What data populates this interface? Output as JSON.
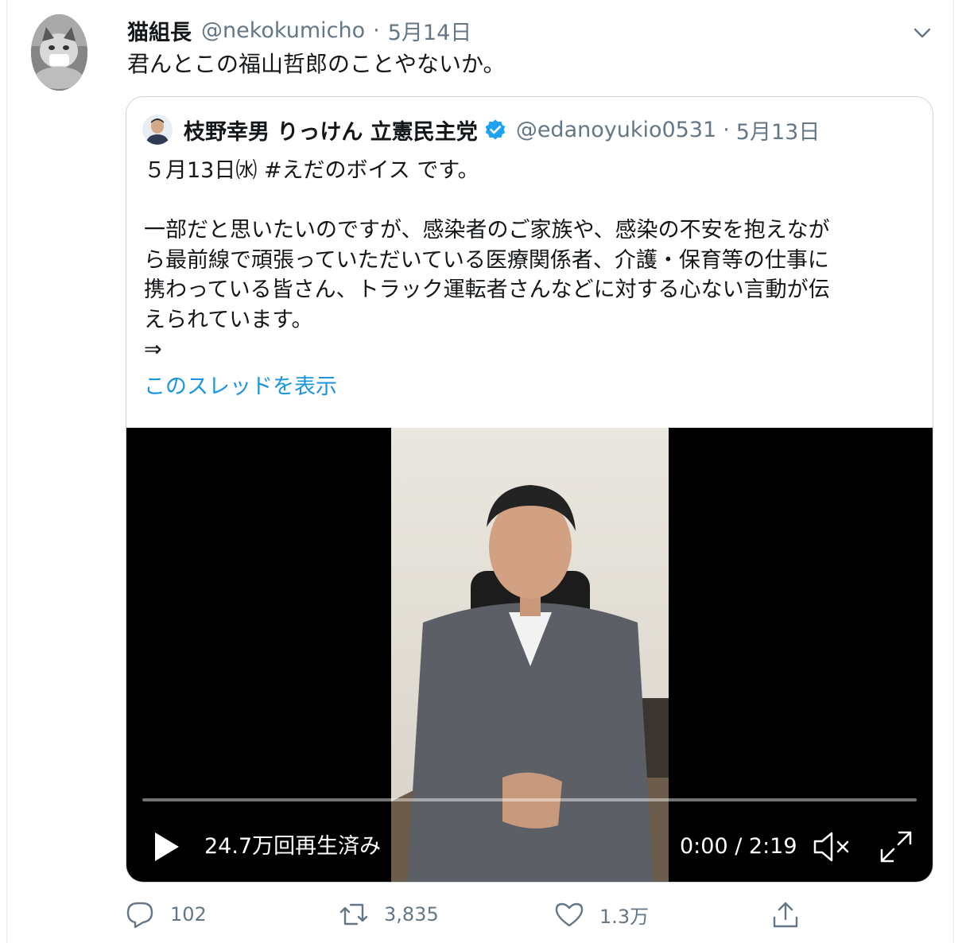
{
  "tweet": {
    "display_name": "猫組長",
    "handle": "@nekokumicho",
    "separator": "·",
    "time": "5月14日",
    "text": "君んとこの福山哲郎のことやないか。"
  },
  "quoted_tweet": {
    "display_name": "枝野幸男 りっけん 立憲民主党",
    "verified": true,
    "handle": "@edanoyukio0531",
    "separator": "·",
    "time": "5月13日",
    "lines": [
      "５月13日㈬ #えだのボイス です。",
      "",
      "一部だと思いたいのですが、感染者のご家族や、感染の不安を抱えなが",
      "ら最前線で頑張っていただいている医療関係者、介護・保育等の仕事に",
      "携わっている皆さん、トラック運転者さんなどに対する心ない言動が伝",
      "えられています。",
      "⇒"
    ],
    "show_thread_link": "このスレッドを表示"
  },
  "video": {
    "views": "24.7万回再生済み",
    "time": "0:00 / 2:19",
    "progress": 0,
    "muted": true
  },
  "actions": {
    "reply_count": "102",
    "retweet_count": "3,835",
    "like_count": "1.3万",
    "share_label": ""
  },
  "colors": {
    "text": "#14171a",
    "secondary": "#657786",
    "link": "#1b95e0",
    "verified": "#1da1f2",
    "border": "#ccd6dd"
  },
  "icons": [
    "chevron-down-icon",
    "verified-badge-icon",
    "play-icon",
    "mute-icon",
    "fullscreen-icon",
    "reply-icon",
    "retweet-icon",
    "like-icon",
    "share-icon"
  ]
}
